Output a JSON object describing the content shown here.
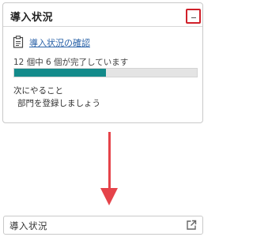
{
  "expanded_panel": {
    "title": "導入状況",
    "collapse_icon": "minus-icon",
    "check_link_icon": "clipboard-icon",
    "check_link": "導入状況の確認",
    "progress_text": "12 個中 6 個が完了しています",
    "progress": {
      "done": 6,
      "total": 12,
      "fraction": 0.5
    },
    "next_title": "次にやること",
    "next_item": "部門を登録しましょう"
  },
  "arrow": {
    "icon": "arrow-down-icon",
    "color": "#e5434a"
  },
  "collapsed_panel": {
    "title": "導入状況",
    "expand_icon": "external-link-icon"
  },
  "colors": {
    "highlight": "#d0202a",
    "progress_fill": "#138a8a",
    "link": "#2a62a8"
  }
}
